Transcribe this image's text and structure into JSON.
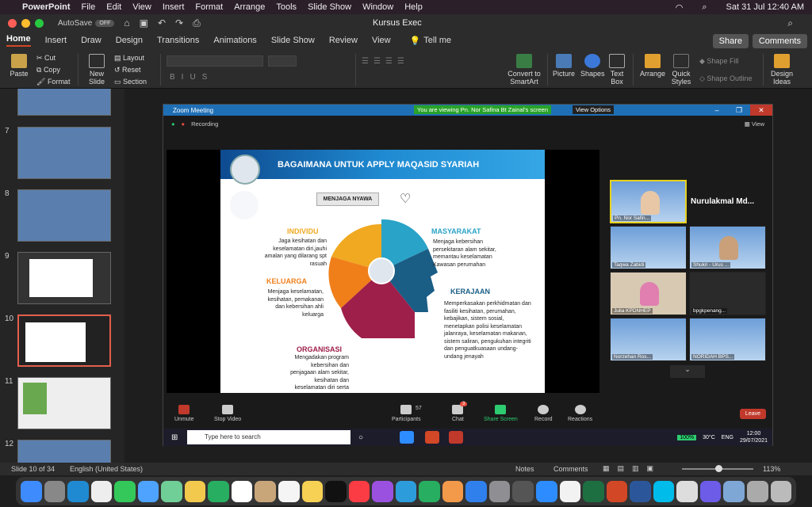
{
  "menubar": {
    "app": "PowerPoint",
    "items": [
      "File",
      "Edit",
      "View",
      "Insert",
      "Format",
      "Arrange",
      "Tools",
      "Slide Show",
      "Window",
      "Help"
    ],
    "clock": "Sat 31 Jul  12:40 AM"
  },
  "titlebar": {
    "autosave": "AutoSave",
    "autosave_state": "OFF",
    "doc_title": "Kursus Exec"
  },
  "ribbon_tabs": [
    "Home",
    "Insert",
    "Draw",
    "Design",
    "Transitions",
    "Animations",
    "Slide Show",
    "Review",
    "View"
  ],
  "tell_me": "Tell me",
  "share": "Share",
  "comments": "Comments",
  "ribbon": {
    "paste": "Paste",
    "cut": "Cut",
    "copy": "Copy",
    "format": "Format",
    "new_slide": "New Slide",
    "layout": "Layout",
    "reset": "Reset",
    "section": "Section",
    "convert": "Convert to SmartArt",
    "picture": "Picture",
    "shapes": "Shapes",
    "textbox": "Text Box",
    "arrange": "Arrange",
    "quick_styles": "Quick Styles",
    "shape_fill": "Shape Fill",
    "shape_outline": "Shape Outline",
    "design_ideas": "Design Ideas"
  },
  "thumbs": [
    {
      "num": "7"
    },
    {
      "num": "8"
    },
    {
      "num": "9"
    },
    {
      "num": "10"
    },
    {
      "num": "11"
    },
    {
      "num": "12"
    }
  ],
  "zoom": {
    "title": "Zoom Meeting",
    "banner": "You are viewing Pn. Nor Safina Bt Zainal's screen",
    "view_options": "View Options",
    "recording": "Recording",
    "view": "View",
    "slide": {
      "title": "BAGAIMANA UNTUK APPLY MAQASID SYARIAH",
      "tag": "MENJAGA NYAWA",
      "individu_h": "INDIVIDU",
      "individu_t": "Jaga kesihatan dan keselamatan diri,jauhi amalan yang dilarang spt rasuah",
      "keluarga_h": "KELUARGA",
      "keluarga_t": "Menjaga keselamatan, kesihatan, pemakanan dan kebersihan ahli keluarga",
      "organisasi_h": "ORGANISASI",
      "organisasi_t": "Mengadakan program kebersihan dan penjagaan alam sekitar, kesihatan dan keselamatan diri serta awam",
      "masyarakat_h": "MASYARAKAT",
      "masyarakat_t": "Menjaga kebersihan persekitaran alam sekitar, memantau keselamatan Kawasan perumahan",
      "kerajaan_h": "KERAJAAN",
      "kerajaan_t": "Memperkasakan perkhidmatan dan fasiliti kesihatan, perumahan, kebajikan, sistem sosial, menetapkan polisi keselamatan jalanraya, keselamatan makanan, sistem saliran, pengukuhan integriti dan penguatkuasaan undang-undang jenayah"
    },
    "active_name": "Nurulakmal  Md...",
    "participants": [
      "Pn. Nor Safin...",
      "Taqwa Zabidi",
      "Shukri - Urus ...",
      "Julia KPDNHEP",
      "bpgkpenang...",
      "Norzehan Ros...",
      "NORIDAH BPS..."
    ],
    "controls": {
      "unmute": "Unmute",
      "stop_video": "Stop Video",
      "participants": "Participants",
      "participants_count": "57",
      "chat": "Chat",
      "chat_badge": "3",
      "share": "Share Screen",
      "record": "Record",
      "reactions": "Reactions",
      "leave": "Leave"
    },
    "taskbar": {
      "search": "Type here to search",
      "battery": "100%",
      "temp": "30°C",
      "lang": "ENG",
      "time": "12:00",
      "date": "29/07/2021"
    }
  },
  "status": {
    "slide": "Slide 10 of 34",
    "lang": "English (United States)",
    "notes": "Notes",
    "comments": "Comments",
    "zoom": "113%"
  },
  "colors": {
    "accent": "#d24726",
    "zoom_blue": "#1f6fb5",
    "individu": "#f0a920",
    "keluarga": "#f07f1a",
    "organisasi": "#9e1f4a",
    "masyarakat": "#29a3c7",
    "kerajaan": "#1a5d85"
  }
}
